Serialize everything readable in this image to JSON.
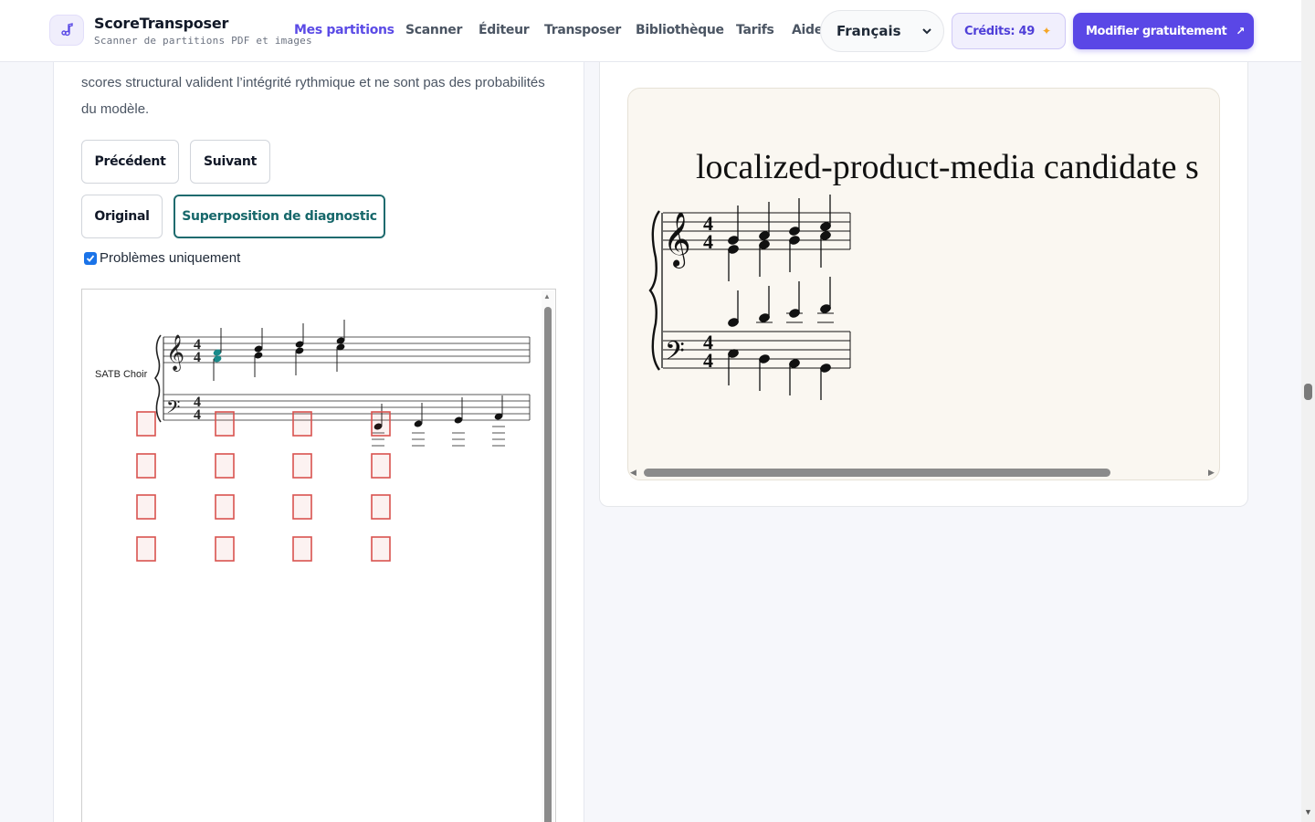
{
  "header": {
    "brand_name": "ScoreTransposer",
    "brand_tagline": "Scanner de partitions PDF et images",
    "nav": [
      {
        "label": "Mes partitions",
        "active": true
      },
      {
        "label": "Scanner",
        "active": false
      },
      {
        "label": "Éditeur",
        "active": false
      },
      {
        "label": "Transposer",
        "active": false
      },
      {
        "label": "Bibliothèque",
        "active": false
      },
      {
        "label": "Tarifs",
        "active": false
      },
      {
        "label": "Aide",
        "active": false
      }
    ],
    "language": "Français",
    "credits_label": "Crédits: 49",
    "cta_label": "Modifier gratuitement"
  },
  "left": {
    "description": "scores structural valident l’intégrité rythmique et ne sont pas des probabilités du modèle.",
    "prev_label": "Précédent",
    "next_label": "Suivant",
    "view_original_label": "Original",
    "view_overlay_label": "Superposition de diagnostic",
    "selected_view": "Superposition de diagnostic",
    "problems_only_label": "Problèmes uniquement",
    "problems_only_checked": true,
    "viewer": {
      "part_label": "SATB Choir",
      "time_signature": "4/4"
    }
  },
  "right": {
    "score_title": "localized-product-media candidate s",
    "time_signature": "4/4"
  },
  "colors": {
    "accent": "#5a47e6",
    "selected_border": "#1f6b6e",
    "overlay_box": "#d9534f",
    "highlight_note": "#1a8a8a"
  }
}
